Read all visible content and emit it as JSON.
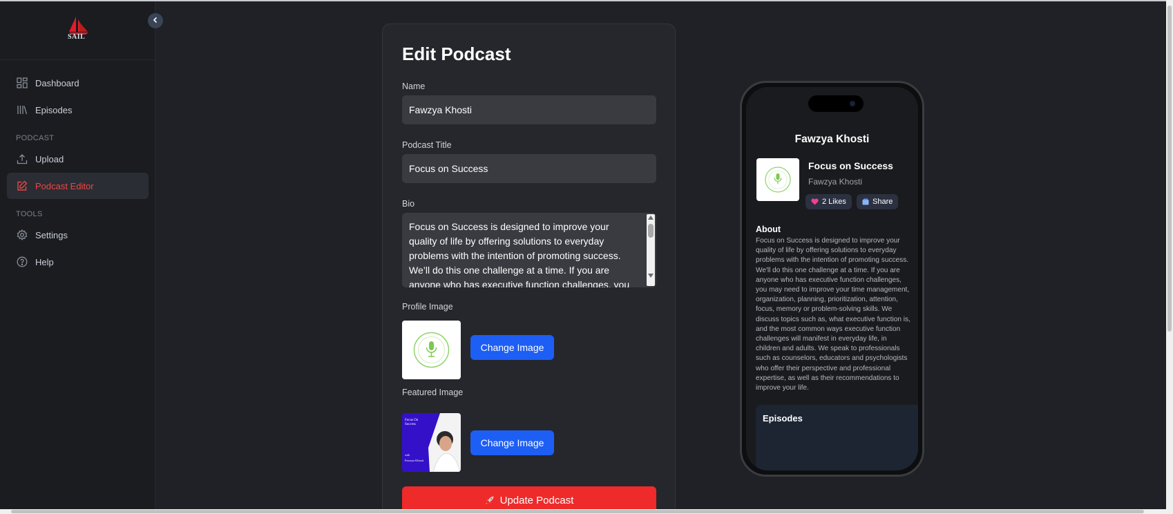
{
  "sidebar": {
    "logo_text": "SAIL",
    "items": [
      {
        "label": "Dashboard",
        "icon": "grid-icon"
      },
      {
        "label": "Episodes",
        "icon": "library-icon"
      },
      {
        "label": "Upload",
        "icon": "upload-icon"
      },
      {
        "label": "Podcast Editor",
        "icon": "edit-icon"
      },
      {
        "label": "Settings",
        "icon": "gear-icon"
      },
      {
        "label": "Help",
        "icon": "help-icon"
      }
    ],
    "section_podcast": "PODCAST",
    "section_tools": "TOOLS",
    "active_color": "#ef4444"
  },
  "form": {
    "title": "Edit Podcast",
    "name_label": "Name",
    "name_value": "Fawzya Khosti",
    "podcast_title_label": "Podcast Title",
    "podcast_title_value": "Focus on Success",
    "bio_label": "Bio",
    "bio_value": "Focus on Success is designed to improve your quality of life by offering solutions to everyday problems with the intention of promoting success. We’ll do this one challenge at a time. If you are anyone who has executive function challenges, you",
    "profile_image_label": "Profile Image",
    "featured_image_label": "Featured Image",
    "change_image_label": "Change Image",
    "update_label": "Update Podcast",
    "featured_image_text": {
      "title": "Focus On Success",
      "with": "with",
      "author": "Fawzya Khosti"
    }
  },
  "preview": {
    "name": "Fawzya Khosti",
    "podcast_title": "Focus on Success",
    "author": "Fawzya Khosti",
    "likes_label": "2 Likes",
    "share_label": "Share",
    "about_heading": "About",
    "about_text": "Focus on Success is designed to improve your quality of life by offering solutions to everyday problems with the intention of promoting success. We'll do this one challenge at a time. If you are anyone who has executive function challenges, you may need to improve your time management, organization, planning, prioritization, attention, focus, memory or problem-solving skills. We discuss topics such as, what executive function is, and the most common ways executive function challenges will manifest in everyday life, in children and adults. We speak to professionals such as counselors, educators and psychologists who offer their perspective and professional expertise, as well as their recommendations to improve your life.",
    "episodes_heading": "Episodes"
  },
  "colors": {
    "accent_blue": "#1d5ef5",
    "accent_red": "#ee2a2a",
    "background": "#1f2126"
  }
}
